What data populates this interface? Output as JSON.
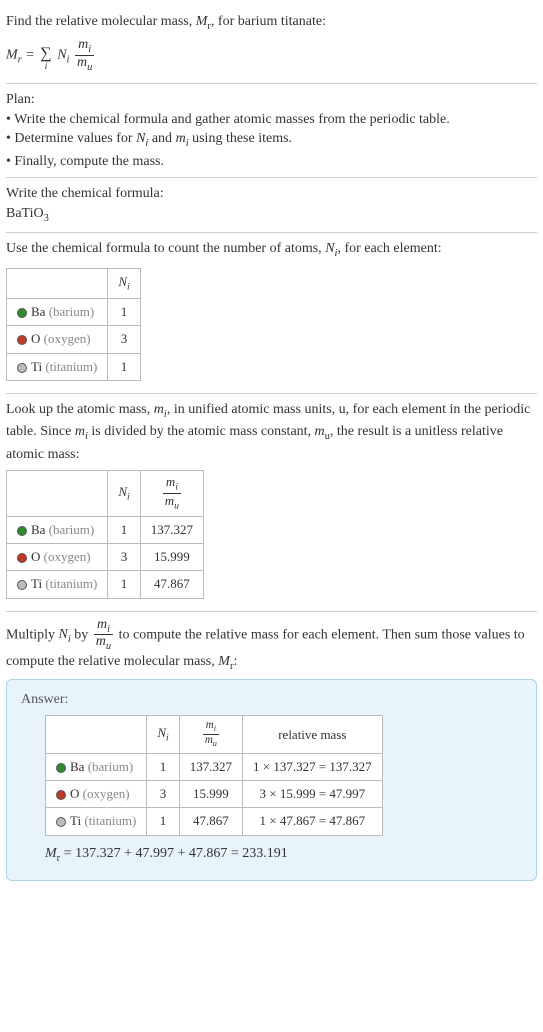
{
  "intro": {
    "line1": "Find the relative molecular mass, M_r, for barium titanate:",
    "formula_html": "M<sub>r</sub> = <span class='sigma'><span class='top'></span><span class='sym'>∑</span><span class='bot'>i</span></span> N<sub>i</sub> <span class='frac'><span class='num'>m<sub>i</sub></span><span class='den'>m<sub>u</sub></span></span>"
  },
  "plan": {
    "heading": "Plan:",
    "items": [
      "• Write the chemical formula and gather atomic masses from the periodic table.",
      "• Determine values for N_i and m_i using these items.",
      "• Finally, compute the mass."
    ]
  },
  "s_formula": {
    "heading": "Write the chemical formula:",
    "formula": "BaTiO",
    "formula_sub": "3"
  },
  "s_count": {
    "heading_html": "Use the chemical formula to count the number of atoms, <i>N<sub>i</sub></i>, for each element:",
    "header_ni_html": "N<sub>i</sub>",
    "rows": [
      {
        "dot": "dot-ba",
        "symbol": "Ba",
        "name": "(barium)",
        "n": "1"
      },
      {
        "dot": "dot-o",
        "symbol": "O",
        "name": "(oxygen)",
        "n": "3"
      },
      {
        "dot": "dot-ti",
        "symbol": "Ti",
        "name": "(titanium)",
        "n": "1"
      }
    ]
  },
  "s_mass": {
    "heading_html": "Look up the atomic mass, <i>m<sub>i</sub></i>, in unified atomic mass units, u, for each element in the periodic table. Since <i>m<sub>i</sub></i> is divided by the atomic mass constant, <i>m</i><sub>u</sub>, the result is a unitless relative atomic mass:",
    "header_ni_html": "N<sub>i</sub>",
    "header_frac_html": "<span class='frac'><span class='num'>m<sub>i</sub></span><span class='den'>m<sub>u</sub></span></span>",
    "rows": [
      {
        "dot": "dot-ba",
        "symbol": "Ba",
        "name": "(barium)",
        "n": "1",
        "m": "137.327"
      },
      {
        "dot": "dot-o",
        "symbol": "O",
        "name": "(oxygen)",
        "n": "3",
        "m": "15.999"
      },
      {
        "dot": "dot-ti",
        "symbol": "Ti",
        "name": "(titanium)",
        "n": "1",
        "m": "47.867"
      }
    ]
  },
  "s_compute": {
    "heading_html": "Multiply <i>N<sub>i</sub></i> by <span class='frac'><span class='num'>m<sub>i</sub></span><span class='den'>m<sub>u</sub></span></span> to compute the relative mass for each element. Then sum those values to compute the relative molecular mass, <i>M</i><sub>r</sub>:"
  },
  "answer": {
    "label": "Answer:",
    "header_ni_html": "N<sub>i</sub>",
    "header_frac_html": "<span class='frac' style='font-size:0.85em'><span class='num'>m<sub>i</sub></span><span class='den'>m<sub>u</sub></span></span>",
    "header_relmass": "relative mass",
    "rows": [
      {
        "dot": "dot-ba",
        "symbol": "Ba",
        "name": "(barium)",
        "n": "1",
        "m": "137.327",
        "calc": "1 × 137.327 = 137.327"
      },
      {
        "dot": "dot-o",
        "symbol": "O",
        "name": "(oxygen)",
        "n": "3",
        "m": "15.999",
        "calc": "3 × 15.999 = 47.997"
      },
      {
        "dot": "dot-ti",
        "symbol": "Ti",
        "name": "(titanium)",
        "n": "1",
        "m": "47.867",
        "calc": "1 × 47.867 = 47.867"
      }
    ],
    "final_html": "<i>M</i><sub>r</sub> = 137.327 + 47.997 + 47.867 = 233.191"
  }
}
